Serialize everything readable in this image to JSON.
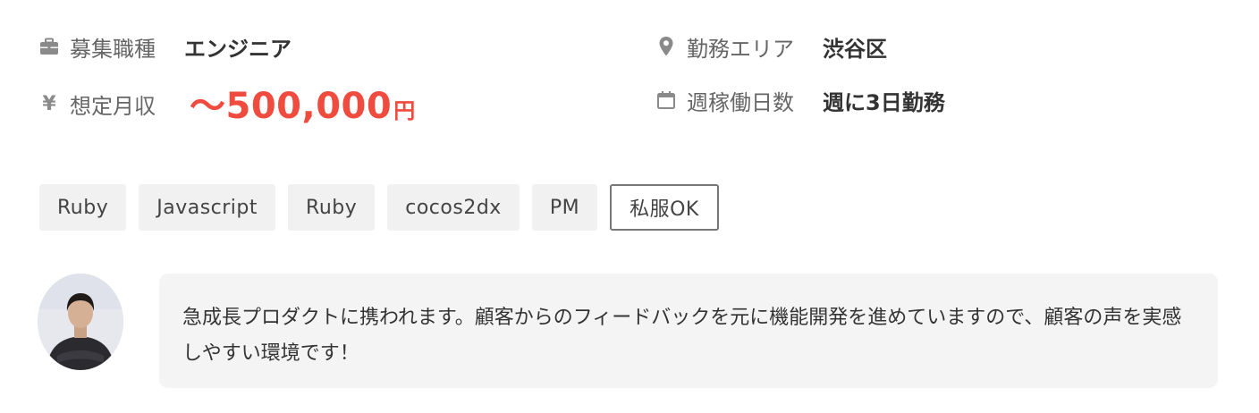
{
  "job_info": {
    "occupation": {
      "icon": "briefcase-icon",
      "label": "募集職種",
      "value": "エンジニア"
    },
    "area": {
      "icon": "map-pin-icon",
      "label": "勤務エリア",
      "value": "渋谷区"
    },
    "salary": {
      "icon": "yen-icon",
      "icon_glyph": "¥",
      "label": "想定月収",
      "amount": "〜500,000",
      "unit": "円"
    },
    "workdays": {
      "icon": "calendar-icon",
      "label": "週稼働日数",
      "value": "週に3日勤務"
    }
  },
  "tags": [
    {
      "label": "Ruby",
      "style": "filled"
    },
    {
      "label": "Javascript",
      "style": "filled"
    },
    {
      "label": "Ruby",
      "style": "filled"
    },
    {
      "label": "cocos2dx",
      "style": "filled"
    },
    {
      "label": "PM",
      "style": "filled"
    },
    {
      "label": "私服OK",
      "style": "outline"
    }
  ],
  "message": {
    "avatar": "person-avatar",
    "text": "急成長プロダクトに携われます。顧客からのフィードバックを元に機能開発を進めていますので、顧客の声を実感しやすい環境です！"
  },
  "colors": {
    "salary": "#ef4b3f",
    "label": "#666666",
    "icon": "#8a8a8a",
    "tag_bg": "#f1f1f1",
    "bubble_bg": "#f4f4f4"
  }
}
